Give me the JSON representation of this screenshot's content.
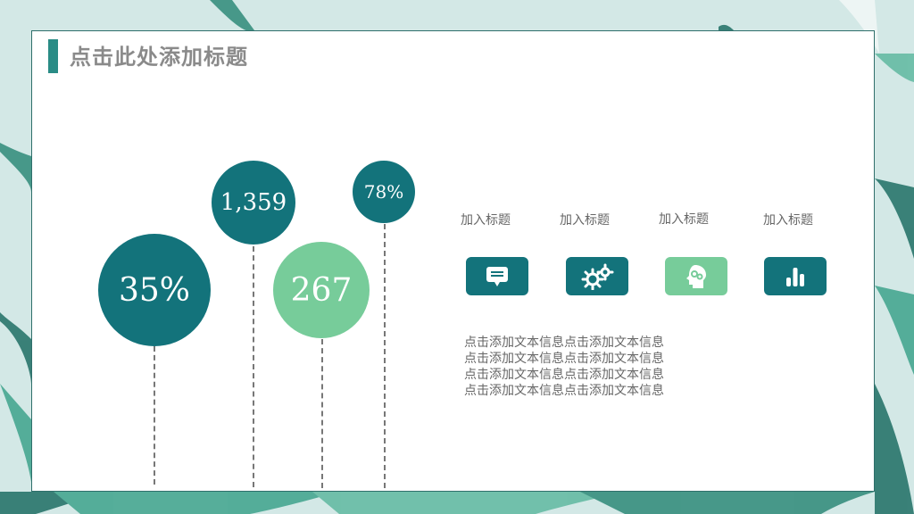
{
  "slide": {
    "title": "点击此处添加标题"
  },
  "stats": [
    {
      "value": "35%",
      "color": "#13737b"
    },
    {
      "value": "1,359",
      "color": "#13737b"
    },
    {
      "value": "267",
      "color": "#77cc9a"
    },
    {
      "value": "78%",
      "color": "#13737b"
    }
  ],
  "features": [
    {
      "label": "加入标题",
      "icon": "message-icon",
      "color": "#13737b"
    },
    {
      "label": "加入标题",
      "icon": "gears-icon",
      "color": "#13737b"
    },
    {
      "label": "加入标题",
      "icon": "head-gears-icon",
      "color": "#77cc9a"
    },
    {
      "label": "加入标题",
      "icon": "bar-chart-icon",
      "color": "#13737b"
    }
  ],
  "description": {
    "lines": [
      "点击添加文本信息点击添加文本信息",
      "点击添加文本信息点击添加文本信息",
      "点击添加文本信息点击添加文本信息",
      "点击添加文本信息点击添加文本信息"
    ]
  }
}
